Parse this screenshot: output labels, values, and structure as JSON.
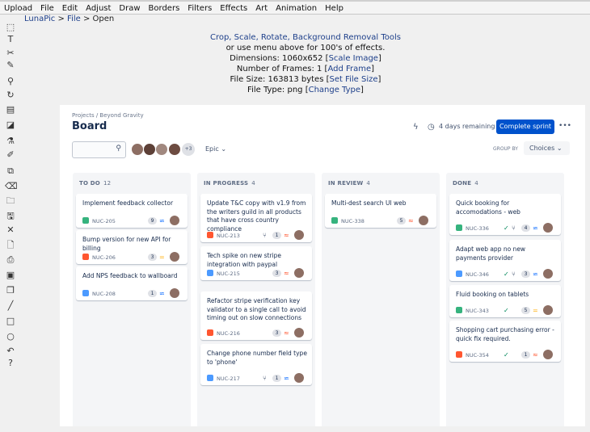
{
  "menu": [
    "Upload",
    "File",
    "Edit",
    "Adjust",
    "Draw",
    "Borders",
    "Filters",
    "Effects",
    "Art",
    "Animation",
    "Help"
  ],
  "breadcrumb": {
    "app": "LunaPic",
    "sep1": " > ",
    "file": "File",
    "sep2": " > ",
    "page": "Open"
  },
  "info": {
    "tools_link": "Crop, Scale, Rotate, Background Removal Tools",
    "line2": "or use menu above for 100's of effects.",
    "dims_label": "Dimensions: 1060x652 [",
    "dims_link": "Scale Image",
    "dims_end": "]",
    "frames_label": "Number of Frames: 1 [",
    "frames_link": "Add Frame",
    "frames_end": "]",
    "size_label": "File Size: 163813 bytes [",
    "size_link": "Set File Size",
    "size_end": "]",
    "type_label": "File Type: png [",
    "type_link": "Change Type",
    "type_end": "]"
  },
  "tools": [
    "marquee-icon",
    "text-icon",
    "scissors-icon",
    "pencil-icon",
    "magnifier-icon",
    "rotate-icon",
    "grid-icon",
    "paint-bucket-icon",
    "dropper-icon",
    "brush-icon",
    "crop-icon",
    "eraser-icon",
    "folder-icon",
    "save-icon",
    "close-icon",
    "document-icon",
    "printer-icon",
    "stamp-icon",
    "copy-icon",
    "line-icon",
    "rectangle-icon",
    "circle-icon",
    "undo-icon",
    "help-icon"
  ],
  "tool_glyphs": [
    "⬚",
    "T",
    "✂",
    "✎",
    "⚲",
    "↻",
    "▤",
    "◪",
    "⚗",
    "✐",
    "⧉",
    "⌫",
    "🗀",
    "🖫",
    "✕",
    "🗋",
    "⎙",
    "▣",
    "❐",
    "╱",
    "□",
    "○",
    "↶",
    "?"
  ],
  "board": {
    "crumbs": "Projects / Beyond Gravity",
    "title": "Board",
    "days": "4 days remaining",
    "complete": "Complete sprint",
    "more": "•••",
    "avatar_more": "+3",
    "epic": "Epic",
    "groupby": "GROUP BY",
    "choices": "Choices"
  },
  "colors": {
    "story": "#36b37e",
    "bug": "#ff5630",
    "task": "#4c9aff",
    "high": "#ff5630",
    "medium": "#ffab00",
    "low": "#0065ff"
  },
  "columns": [
    {
      "title": "TO DO",
      "count": "12",
      "cards": [
        {
          "text": "Implement feedback collector",
          "key": "NUC-205",
          "est": "9",
          "priority": "low",
          "type": "story"
        },
        {
          "text": "Bump version for new API for billing",
          "key": "NUC-206",
          "est": "3",
          "priority": "medium",
          "type": "bug"
        },
        {
          "text": "Add NPS feedback to wallboard",
          "key": "NUC-208",
          "est": "1",
          "priority": "low",
          "type": "task"
        }
      ]
    },
    {
      "title": "IN PROGRESS",
      "count": "4",
      "cards": [
        {
          "text": "Update T&C copy with v1.9 from the writers guild in all products that have cross country compliance",
          "key": "NUC-213",
          "est": "1",
          "priority": "high",
          "type": "bug",
          "branch": true
        },
        {
          "text": "Tech spike on new stripe integration with paypal",
          "key": "NUC-215",
          "est": "3",
          "priority": "high",
          "type": "task"
        },
        {
          "text": "Refactor stripe verification key validator to a single call to avoid timing out on slow connections",
          "key": "NUC-216",
          "est": "3",
          "priority": "high",
          "type": "bug"
        },
        {
          "text": "Change phone number field type to 'phone'",
          "key": "NUC-217",
          "est": "1",
          "priority": "low",
          "type": "task",
          "branch": true
        }
      ]
    },
    {
      "title": "IN REVIEW",
      "count": "4",
      "cards": [
        {
          "text": "Multi-dest search UI web",
          "key": "NUC-338",
          "est": "5",
          "priority": "high",
          "type": "story"
        }
      ]
    },
    {
      "title": "DONE",
      "count": "4",
      "cards": [
        {
          "text": "Quick booking for accomodations - web",
          "key": "NUC-336",
          "est": "4",
          "priority": "low",
          "type": "story",
          "check": true,
          "branch": true
        },
        {
          "text": "Adapt web app no new payments provider",
          "key": "NUC-346",
          "est": "3",
          "priority": "low",
          "type": "task",
          "check": true,
          "branch": true
        },
        {
          "text": "Fluid booking on tablets",
          "key": "NUC-343",
          "est": "5",
          "priority": "medium",
          "type": "story",
          "check": true
        },
        {
          "text": "Shopping cart purchasing error - quick fix required.",
          "key": "NUC-354",
          "est": "1",
          "priority": "high",
          "type": "bug",
          "check": true
        }
      ]
    }
  ]
}
